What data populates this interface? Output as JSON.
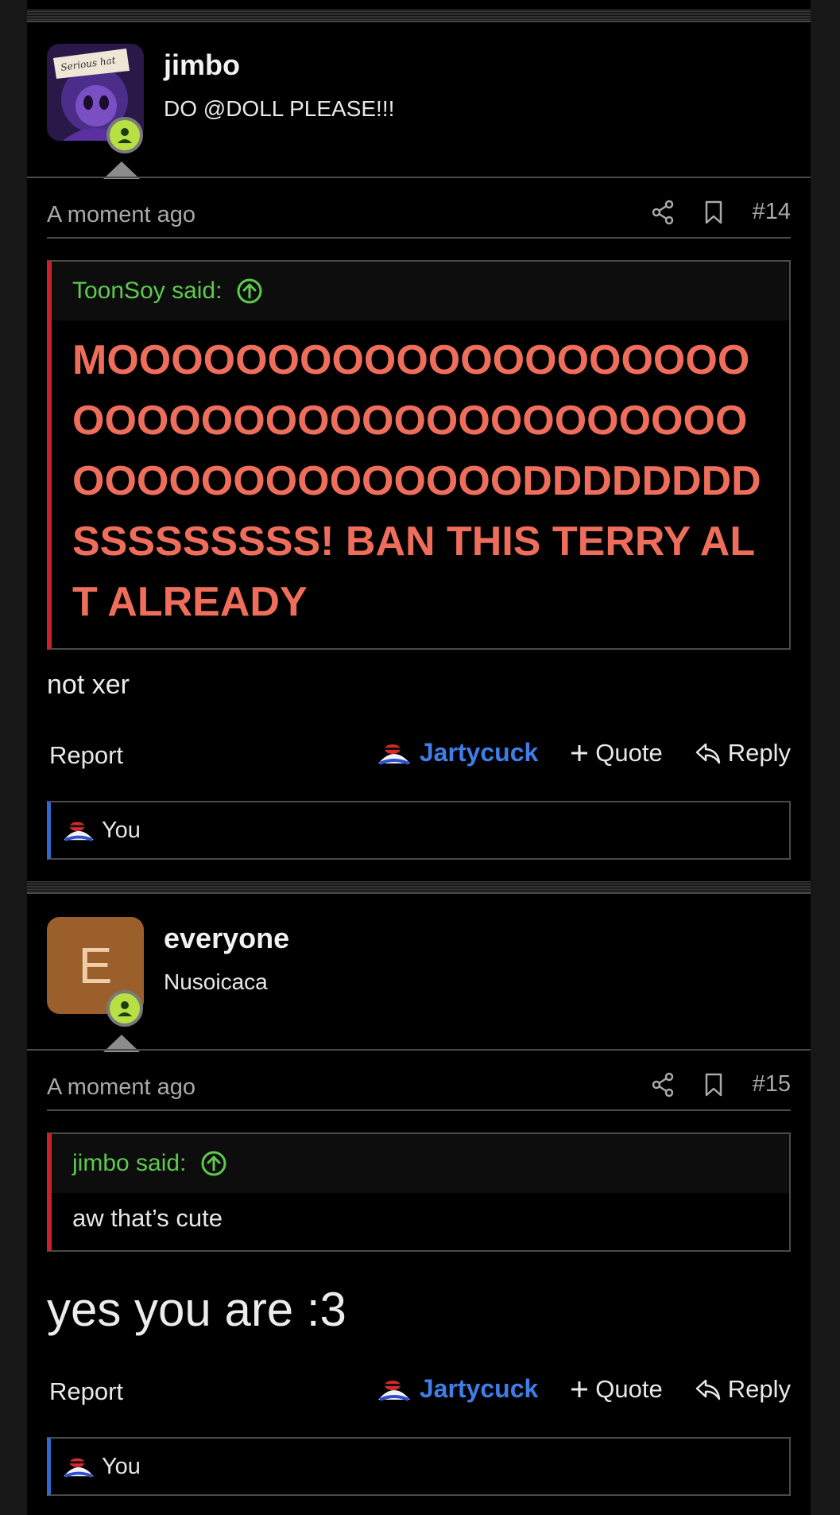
{
  "posts": [
    {
      "username": "jimbo",
      "user_title": "DO @DOLL PLEASE!!!",
      "avatar_caption": "Serious hat",
      "time": "A moment ago",
      "post_number": "#14",
      "quote": {
        "author_label": "ToonSoy said:",
        "text": "MOOOOOOOOOOOOOOOOOOOOOOOOOOOOOOOOOOOOOOOOOOOOOOOOOOOOOOODDDDDDDDSSSSSSSSS! BAN THIS TERRY ALT ALREADY"
      },
      "body": "not xer",
      "reaction_user": "Jartycuck",
      "liked_by": "You"
    },
    {
      "username": "everyone",
      "user_title": "Nusoicaca",
      "avatar_letter": "E",
      "time": "A moment ago",
      "post_number": "#15",
      "quote": {
        "author_label": "jimbo said:",
        "text": "aw that’s cute"
      },
      "body": "yes you are :3",
      "reaction_user": "Jartycuck",
      "liked_by": "You"
    }
  ],
  "actions": {
    "report": "Report",
    "quote": "Quote",
    "reply": "Reply"
  },
  "colors": {
    "quote_author": "#5ec94f",
    "quote_bar": "#c8232c",
    "reaction": "#3f7ee8",
    "online": "#b8e043",
    "shout": "#ee6e5b"
  },
  "icons": [
    "share-icon",
    "bookmark-icon",
    "arrow-up-circle-icon",
    "plus-icon",
    "reply-icon",
    "online-status-icon"
  ]
}
